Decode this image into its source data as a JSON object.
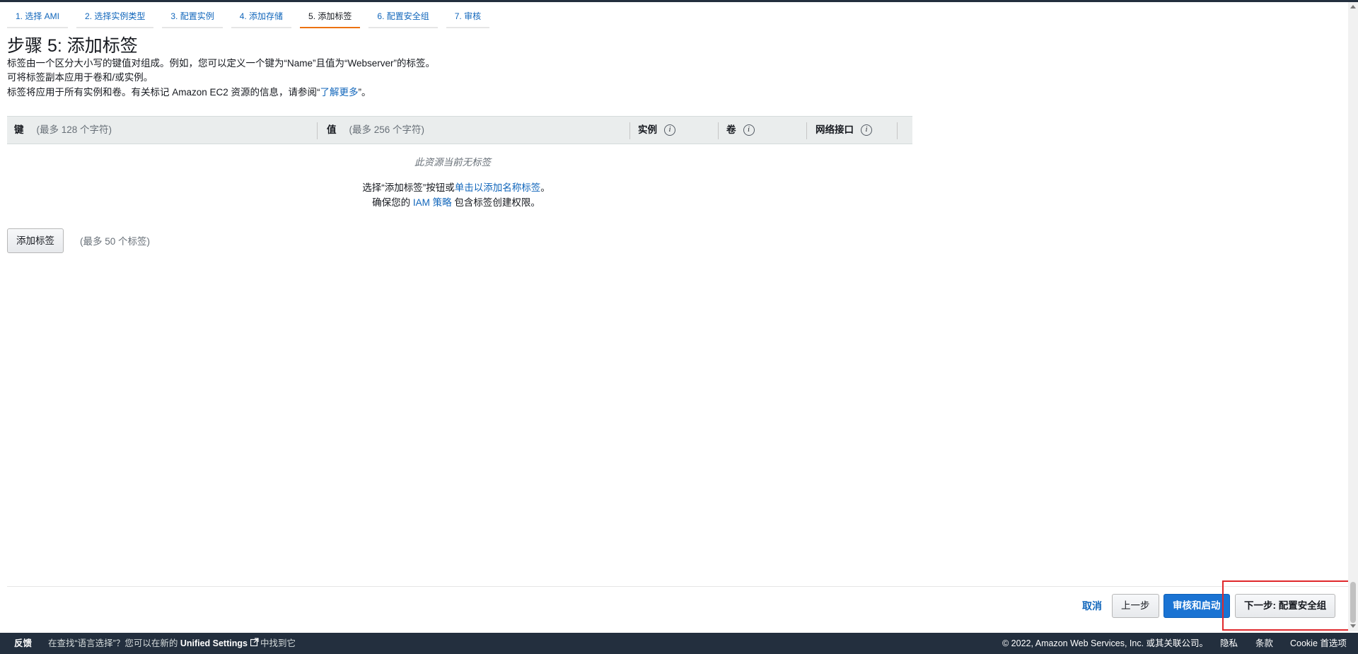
{
  "steps": [
    {
      "label": "1. 选择 AMI"
    },
    {
      "label": "2. 选择实例类型"
    },
    {
      "label": "3. 配置实例"
    },
    {
      "label": "4. 添加存储"
    },
    {
      "label": "5. 添加标签"
    },
    {
      "label": "6. 配置安全组"
    },
    {
      "label": "7. 审核"
    }
  ],
  "active_step": "5. 添加标签",
  "page": {
    "title": "步骤 5: 添加标签",
    "desc1": "标签由一个区分大小写的键值对组成。例如，您可以定义一个键为“Name”且值为“Webserver”的标签。",
    "desc2": "可将标签副本应用于卷和/或实例。",
    "desc3_prefix": "标签将应用于所有实例和卷。有关标记 Amazon EC2 资源的信息，请参阅“",
    "desc3_link": "了解更多",
    "desc3_suffix": "”。"
  },
  "table": {
    "key_header": "键",
    "key_hint": "(最多 128 个字符)",
    "value_header": "值",
    "value_hint": "(最多 256 个字符)",
    "instances_header": "实例",
    "volumes_header": "卷",
    "network_header": "网络接口",
    "info_glyph": "i",
    "empty_message": "此资源当前无标签",
    "instruction_prefix": "选择“添加标签”按钮或",
    "instruction_link": "单击以添加名称标签",
    "instruction_suffix": "。",
    "iam_prefix": "确保您的",
    "iam_link": "IAM 策略",
    "iam_suffix": "包含标签创建权限。"
  },
  "add_tag": {
    "button_label": "添加标签",
    "max_note": "(最多 50 个标签)"
  },
  "actions": {
    "cancel": "取消",
    "previous": "上一步",
    "review_launch": "审核和启动",
    "next": "下一步: 配置安全组"
  },
  "footer": {
    "feedback": "反馈",
    "msg_prefix": "在查找“语言选择”？您可以在新的",
    "msg_bold": "Unified Settings",
    "msg_suffix": "中找到它",
    "copyright": "© 2022, Amazon Web Services, Inc. 或其关联公司。",
    "privacy": "隐私",
    "terms": "条款",
    "cookie": "Cookie 首选项"
  },
  "colors": {
    "accent_link": "#1166bb",
    "active_step_underline": "#ec7211",
    "primary_button": "#1a73d3",
    "footer_bg": "#232f3e",
    "highlight_box": "#e0282b"
  },
  "icons": {
    "info": "info-circle-icon",
    "external": "external-link-icon"
  }
}
